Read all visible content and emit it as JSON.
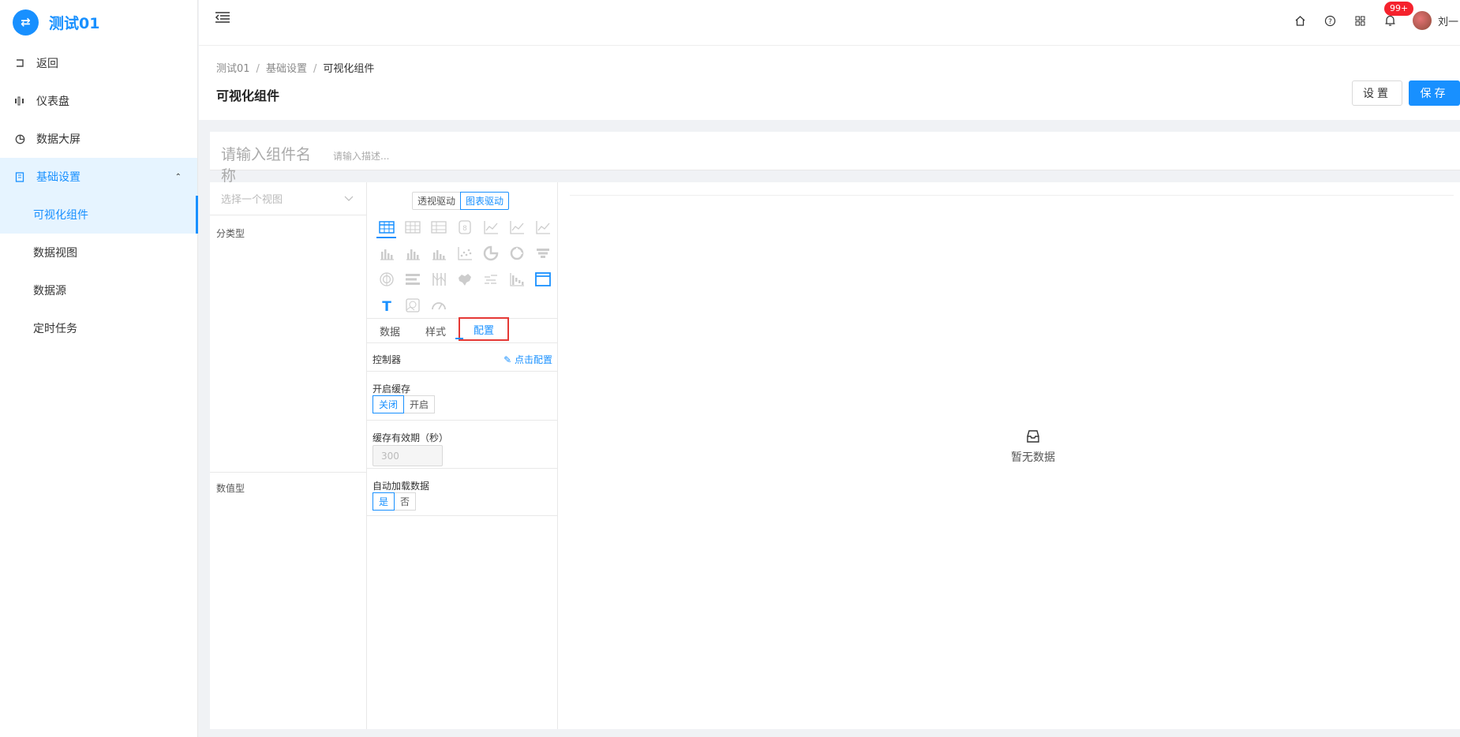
{
  "app": {
    "logo_glyph": "⇄",
    "title": "测试01"
  },
  "sidebar": {
    "items": [
      {
        "label": "返回",
        "icon": "return-icon"
      },
      {
        "label": "仪表盘",
        "icon": "dashboard-icon"
      },
      {
        "label": "数据大屏",
        "icon": "pie-icon"
      },
      {
        "label": "基础设置",
        "icon": "book-icon",
        "open": true
      }
    ],
    "sub_items": [
      {
        "label": "可视化组件",
        "active": true
      },
      {
        "label": "数据视图"
      },
      {
        "label": "数据源"
      },
      {
        "label": "定时任务"
      }
    ]
  },
  "header": {
    "notification_badge": "99+",
    "username": "刘一"
  },
  "breadcrumb": {
    "items": [
      "测试01",
      "基础设置",
      "可视化组件"
    ],
    "separator": "/"
  },
  "page": {
    "title": "可视化组件",
    "settings_label": "设置",
    "save_label": "保存"
  },
  "component": {
    "name_placeholder": "请输入组件名称",
    "desc_placeholder": "请输入描述..."
  },
  "view_select": {
    "placeholder": "选择一个视图"
  },
  "fields": {
    "dimension_label": "分类型",
    "measure_label": "数值型"
  },
  "drive_mode": {
    "options": [
      "透视驱动",
      "图表驱动"
    ],
    "selected": "图表驱动"
  },
  "chart_types": [
    "table-icon",
    "table-icon",
    "table-icon",
    "number-card-icon",
    "line-chart-icon",
    "line-chart-icon",
    "line-chart-icon",
    "bar-chart-icon",
    "bar-chart-icon",
    "bar-chart-icon",
    "scatter-icon",
    "pie-chart-icon",
    "donut-chart-icon",
    "funnel-icon",
    "rose-chart-icon",
    "horizontal-bar-icon",
    "parallel-icon",
    "map-icon",
    "wordcloud-icon",
    "waterfall-icon",
    "iframe-icon",
    "text-icon",
    "image-icon",
    "gauge-icon"
  ],
  "tabs": {
    "items": [
      "数据",
      "样式",
      "配置"
    ],
    "selected": "配置"
  },
  "config": {
    "controller_label": "控制器",
    "controller_link": "点击配置",
    "cache_label": "开启缓存",
    "cache_options": [
      "关闭",
      "开启"
    ],
    "cache_selected": "关闭",
    "expire_label": "缓存有效期（秒）",
    "expire_placeholder": "300",
    "autoload_label": "自动加载数据",
    "autoload_options": [
      "是",
      "否"
    ],
    "autoload_selected": "是"
  },
  "preview": {
    "empty_text": "暂无数据"
  },
  "colors": {
    "primary": "#1890ff",
    "highlight_border": "#e53935",
    "badge": "#f5222d"
  }
}
